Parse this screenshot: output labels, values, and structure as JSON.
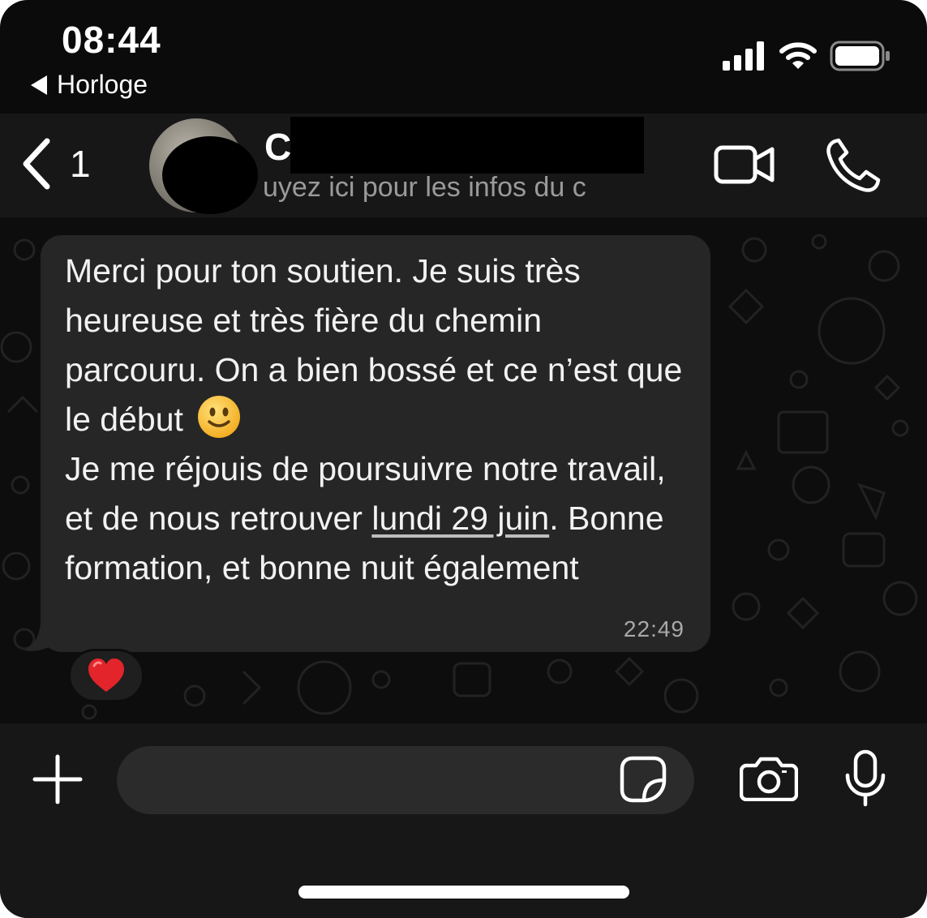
{
  "status_bar": {
    "time": "08:44",
    "back_app_label": "Horloge",
    "icons": [
      "signal-icon",
      "wifi-icon",
      "battery-icon"
    ]
  },
  "header": {
    "back_count": "1",
    "contact_name_visible": "C",
    "subtitle": "uyez ici pour les infos du c",
    "actions": [
      "video-call-icon",
      "phone-call-icon"
    ]
  },
  "message": {
    "text_before_link": "Merci pour ton soutien. Je suis très heureuse et très fière du chemin parcouru. On a bien bossé et ce n’est que le début ",
    "emoji": "slightly-smiling-face",
    "text_line2_before_link": "Je me réjouis de poursuivre notre travail, et de nous retrouver ",
    "link_text": "lundi 29 juin",
    "text_after_link": ". Bonne formation, et bonne nuit également",
    "time": "22:49",
    "reaction": "❤️"
  },
  "input_bar": {
    "placeholder": "",
    "icons": [
      "plus-icon",
      "sticker-icon",
      "camera-icon",
      "microphone-icon"
    ]
  },
  "colors": {
    "background": "#0b0b0b",
    "header": "#171717",
    "bubble": "#262626",
    "input": "#2b2b2b",
    "text_secondary": "#9a9a9a"
  }
}
